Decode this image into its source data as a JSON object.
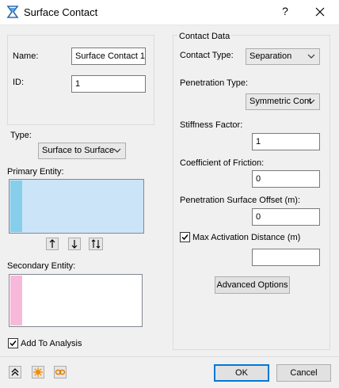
{
  "window": {
    "title": "Surface Contact",
    "help_glyph": "?"
  },
  "left": {
    "name_label": "Name:",
    "name_value": "Surface Contact 1",
    "id_label": "ID:",
    "id_value": "1",
    "type_label": "Type:",
    "type_value": "Surface to Surface",
    "primary_label": "Primary Entity:",
    "secondary_label": "Secondary Entity:",
    "add_to_analysis_label": "Add To Analysis",
    "add_to_analysis_checked": true,
    "primary_swatch_color": "#87ceeb",
    "secondary_swatch_color": "#f7b9d9"
  },
  "right": {
    "group_title": "Contact Data",
    "contact_type_label": "Contact Type:",
    "contact_type_value": "Separation",
    "penetration_type_label": "Penetration Type:",
    "penetration_type_value": "Symmetric Cont",
    "stiffness_label": "Stiffness Factor:",
    "stiffness_value": "1",
    "friction_label": "Coefficient of Friction:",
    "friction_value": "0",
    "offset_label": "Penetration Surface Offset (m):",
    "offset_value": "0",
    "max_activation_label": "Max Activation Distance (m)",
    "max_activation_checked": true,
    "max_activation_value": "",
    "advanced_button": "Advanced Options"
  },
  "footer": {
    "ok": "OK",
    "cancel": "Cancel"
  }
}
